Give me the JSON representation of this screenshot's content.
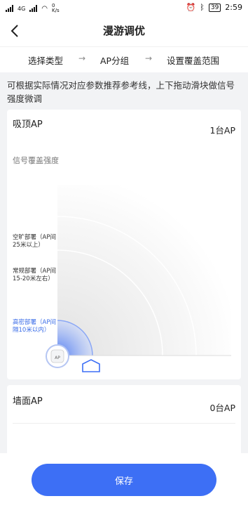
{
  "status_bar": {
    "carrier_left": "4G",
    "net_speed": "0\nK/s",
    "battery": "39",
    "time": "2:59"
  },
  "header": {
    "title": "漫游调优"
  },
  "steps": {
    "items": [
      "选择类型",
      "AP分组",
      "设置覆盖范围"
    ]
  },
  "hint": "可根据实际情况对应参数推荐参考线，上下拖动滑块做信号强度微调",
  "ceiling_card": {
    "title": "吸顶AP",
    "count": "1台AP",
    "coverage_label": "信号覆盖强度",
    "zones": {
      "open": "空旷部署（AP间25米以上）",
      "regular": "常规部署（AP间15-20米左右）",
      "dense": "高密部署（AP间隔10米以内）"
    },
    "ap_badge": "AP"
  },
  "wall_card": {
    "title": "墙面AP",
    "count": "0台AP"
  },
  "footer": {
    "save_label": "保存"
  },
  "colors": {
    "accent": "#3d6ff5",
    "background": "#f2f3f5"
  }
}
